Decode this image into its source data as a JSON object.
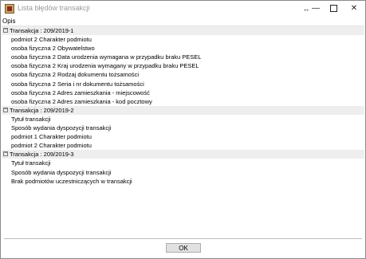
{
  "window": {
    "title": "Lista błędów transakcji"
  },
  "titlebar_buttons": {
    "resize": "↔",
    "minimize": "—",
    "close": "✕"
  },
  "header": "Opis",
  "groups": [
    {
      "label": "Transakcja : 209/2019-1",
      "items": [
        "podmiot 2 Charakter podmiotu",
        "osoba fizyczna 2 Obywatelstwo",
        "osoba fizyczna 2 Data urodzenia wymagana w przypadku braku PESEL",
        "osoba fizyczna 2 Kraj urodzenia wymagany w przypadku braku PESEL",
        "osoba fizyczna 2 Rodzaj dokumentu tożsamości",
        "osoba fizyczna 2 Seria i nr dokumentu tożsamości",
        "osoba fizyczna 2 Adres zamieszkania - miejscowość",
        "osoba fizyczna 2 Adres zamieszkania - kod pocztowy"
      ]
    },
    {
      "label": "Transakcja : 209/2019-2",
      "items": [
        "Tytuł transakcji",
        "Sposób wydania dyspozycji transakcji",
        "podmiot 1 Charakter podmiotu",
        "podmiot 2 Charakter podmiotu"
      ]
    },
    {
      "label": "Transakcja : 209/2019-3",
      "items": [
        "Tytuł transakcji",
        "Sposób wydania dyspozycji transakcji",
        "Brak podmiotów uczestniczących w transakcji"
      ]
    }
  ],
  "ok_label": "OK"
}
